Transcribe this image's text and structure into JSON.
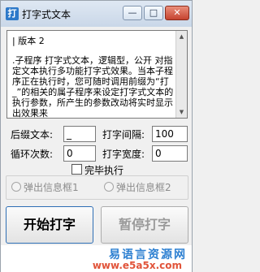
{
  "window": {
    "title": "打字式文本",
    "minimize_glyph": "—",
    "maximize_glyph": "□",
    "close_glyph": "✕",
    "app_icon": "打"
  },
  "textbox": {
    "line1": "| 版本 2",
    "paragraph": ".子程序 打字式文本，逻辑型，公开 对指定文本执行多功能打字式效果。当本子程序正在执行时，您可随时调用前缀为“打_”的相关的属子程序来设定打字式文本的执行参数，所产生的参数改动将实时显示出效果来"
  },
  "fields": {
    "prefix_label": "后缀文本:",
    "prefix_value": "_",
    "interval_label": "打字间隔:",
    "interval_value": "100",
    "loop_label": "循环次数:",
    "loop_value": "0",
    "width_label": "打字宽度:",
    "width_value": "0"
  },
  "checkbox": {
    "label": "完毕执行",
    "checked": false
  },
  "radios": [
    {
      "label": "弹出信息框1",
      "enabled": false
    },
    {
      "label": "弹出信息框2",
      "enabled": false
    }
  ],
  "buttons": {
    "start": "开始打字",
    "pause": "暂停打字"
  },
  "watermark": {
    "line1": "易语言资源网",
    "line2": "www.e5a5x.com"
  }
}
